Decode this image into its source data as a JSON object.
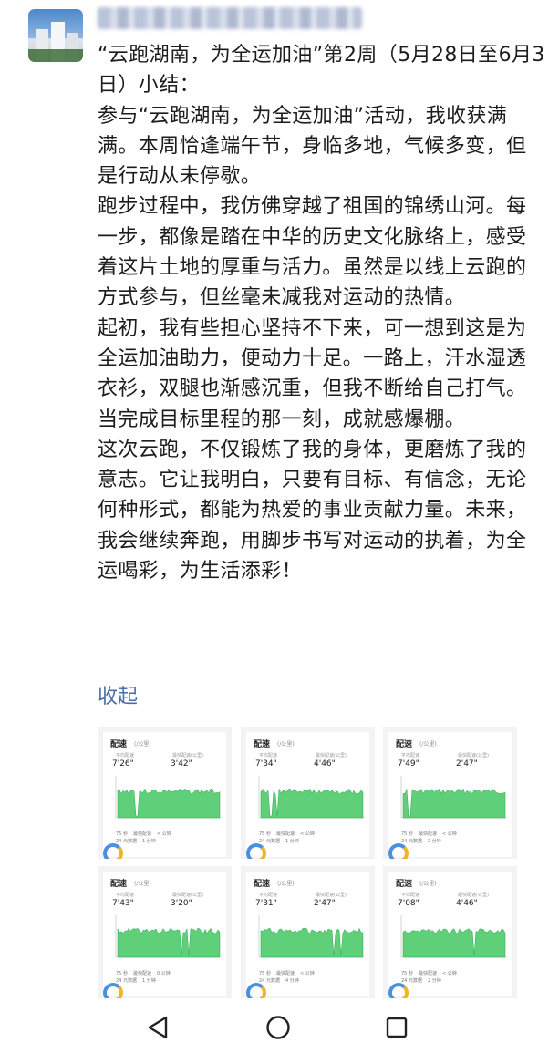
{
  "post": {
    "paragraphs": [
      "“云跑湖南，为全运加油”第2周（5月28日至6月3日）小结：",
      "参与“云跑湖南，为全运加油”活动，我收获满满。本周恰逢端午节，身临多地，气候多变，但是行动从未停歇。",
      "跑步过程中，我仿佛穿越了祖国的锦绣山河。每一步，都像是踏在中华的历史文化脉络上，感受着这片土地的厚重与活力。虽然是以线上云跑的方式参与，但丝毫未减我对运动的热情。",
      "起初，我有些担心坚持不下来，可一想到这是为全运加油助力，便动力十足。一路上，汗水湿透衣衫，双腿也渐感沉重，但我不断给自己打气。当完成目标里程的那一刻，成就感爆棚。",
      "这次云跑，不仅锻炼了我的身体，更磨炼了我的意志。它让我明白，只要有目标、有信念，无论何种形式，都能为热爱的事业贡献力量。未来，我会继续奔跑，用脚步书写对运动的执着，为全运喝彩，为生活添彩！"
    ],
    "collapse_label": "收起"
  },
  "cards": [
    {
      "title": "配速",
      "unit": "(/公里)",
      "avg_label": "平均配速",
      "best_label": "最快配速(公里)",
      "avg": "7'26\"",
      "best": "3'42\"",
      "legend": [
        "75 秒",
        "最快配速",
        "< 公钟",
        "24 元数据",
        "1 分钟"
      ],
      "spikes": [
        0.18,
        0.2
      ]
    },
    {
      "title": "配速",
      "unit": "(/公里)",
      "avg_label": "平均配速",
      "best_label": "最快配速(公里)",
      "avg": "7'34\"",
      "best": "4'46\"",
      "legend": [
        "75 秒",
        "最快配速",
        "< 公钟",
        "24 元数据",
        "1 分钟"
      ],
      "spikes": [
        0.1,
        0.16
      ]
    },
    {
      "title": "配速",
      "unit": "(/公里)",
      "avg_label": "平均配速",
      "best_label": "最快配速(公里)",
      "avg": "7'49\"",
      "best": "2'47\"",
      "legend": [
        "75 秒",
        "最快配速",
        "< 公钟",
        "24 元数据",
        "2 分钟"
      ],
      "spikes": [
        0.06
      ]
    },
    {
      "title": "配速",
      "unit": "(/公里)",
      "avg_label": "平均配速",
      "best_label": "最快配速(公里)",
      "avg": "7'43\"",
      "best": "3'20\"",
      "legend": [
        "75 秒",
        "最快配速",
        "0 公钟",
        "24 元数据",
        "1 分钟"
      ],
      "spikes": [
        0.62,
        0.7
      ]
    },
    {
      "title": "配速",
      "unit": "(/公里)",
      "avg_label": "平均配速",
      "best_label": "最快配速(公里)",
      "avg": "7'31\"",
      "best": "2'47\"",
      "legend": [
        "75 秒",
        "最快配速",
        "< 公钟",
        "24 元数据",
        "4 分钟"
      ],
      "spikes": [
        0.72,
        0.78
      ]
    },
    {
      "title": "配速",
      "unit": "(/公里)",
      "avg_label": "平均配速",
      "best_label": "最快配速(公里)",
      "avg": "7'08\"",
      "best": "4'46\"",
      "legend": [
        "75 秒",
        "最快配速",
        "< 公钟",
        "24 元数据",
        "2 分钟"
      ],
      "spikes": [
        0.7
      ]
    }
  ],
  "colors": {
    "link": "#4b6cab",
    "chart_fill": "#5fcf7a",
    "chart_line": "#2fa84f"
  },
  "nav": {
    "icons": [
      "back-triangle-icon",
      "home-circle-icon",
      "recents-square-icon"
    ]
  }
}
